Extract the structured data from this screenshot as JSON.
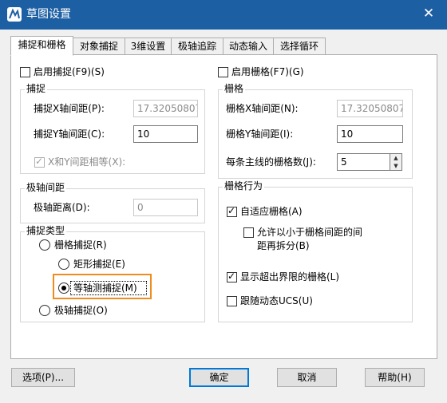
{
  "window": {
    "title": "草图设置",
    "close_glyph": "✕"
  },
  "tabs": [
    {
      "label": "捕捉和栅格",
      "active": true
    },
    {
      "label": "对象捕捉"
    },
    {
      "label": "3维设置"
    },
    {
      "label": "极轴追踪"
    },
    {
      "label": "动态输入"
    },
    {
      "label": "选择循环"
    }
  ],
  "snap": {
    "enable_label": "启用捕捉(F9)(S)",
    "enabled": false,
    "group_label": "捕捉",
    "x_spacing_label": "捕捉X轴间距(P):",
    "x_spacing_value": "17.32050807",
    "y_spacing_label": "捕捉Y轴间距(C):",
    "y_spacing_value": "10",
    "equal_xy_label": "X和Y间距相等(X):",
    "equal_xy_checked": true
  },
  "polar": {
    "group_label": "极轴间距",
    "distance_label": "极轴距离(D):",
    "distance_value": "0"
  },
  "snap_type": {
    "group_label": "捕捉类型",
    "grid_snap_label": "栅格捕捉(R)",
    "rect_snap_label": "矩形捕捉(E)",
    "iso_snap_label": "等轴测捕捉(M)",
    "polar_snap_label": "极轴捕捉(O)",
    "selected": "iso"
  },
  "grid": {
    "enable_label": "启用栅格(F7)(G)",
    "enabled": false,
    "group_label": "栅格",
    "x_spacing_label": "栅格X轴间距(N):",
    "x_spacing_value": "17.32050807",
    "y_spacing_label": "栅格Y轴间距(I):",
    "y_spacing_value": "10",
    "major_label": "每条主线的栅格数(J):",
    "major_value": "5"
  },
  "grid_behavior": {
    "group_label": "栅格行为",
    "adaptive_label": "自适应栅格(A)",
    "adaptive_checked": true,
    "allow_sub_line1": "允许以小于栅格间距的间",
    "allow_sub_line2": "距再拆分(B)",
    "allow_sub_checked": false,
    "beyond_limits_label": "显示超出界限的栅格(L)",
    "beyond_limits_checked": true,
    "follow_ucs_label": "跟随动态UCS(U)",
    "follow_ucs_checked": false
  },
  "buttons": {
    "options": "选项(P)...",
    "ok": "确定",
    "cancel": "取消",
    "help": "帮助(H)"
  }
}
